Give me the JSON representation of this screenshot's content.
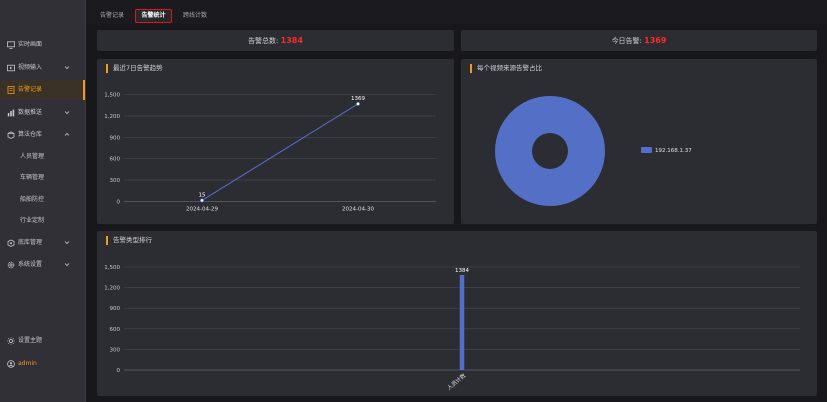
{
  "sidebar": {
    "items": [
      {
        "label": "实时画面",
        "icon": "monitor-icon"
      },
      {
        "label": "视频输入",
        "icon": "video-input-icon"
      },
      {
        "label": "告警记录",
        "icon": "alarm-record-icon"
      },
      {
        "label": "数据推送",
        "icon": "data-push-icon"
      },
      {
        "label": "算法仓库",
        "icon": "algorithm-icon"
      },
      {
        "label": "人员管理"
      },
      {
        "label": "车辆管理"
      },
      {
        "label": "船舶防控"
      },
      {
        "label": "行业定制"
      },
      {
        "label": "底库管理",
        "icon": "gallery-icon"
      },
      {
        "label": "系统设置",
        "icon": "settings-icon"
      }
    ],
    "theme_label": "设置主题",
    "user_label": "admin"
  },
  "tabs": [
    "告警记录",
    "告警统计",
    "跨线计数"
  ],
  "stats": {
    "total_label": "告警总数:",
    "total_value": "1384",
    "today_label": "今日告警:",
    "today_value": "1369"
  },
  "colors": {
    "accent": "#f39a1a",
    "alert": "#ff2a2a",
    "series": "#5470c6"
  },
  "charts": {
    "trend_title": "最近7日告警趋势",
    "source_title": "每个视频来源告警占比",
    "type_title": "告警类型排行"
  },
  "chart_data": [
    {
      "type": "line",
      "title": "最近7日告警趋势",
      "x": [
        "2024-04-29",
        "2024-04-30"
      ],
      "y_ticks": [
        "0",
        "300",
        "600",
        "900",
        "1,200",
        "1,500"
      ],
      "series": [
        {
          "values": [
            15,
            1369
          ],
          "labels": [
            "15",
            "1369"
          ]
        }
      ],
      "ylim": [
        0,
        1500
      ],
      "grid": true
    },
    {
      "type": "pie",
      "title": "每个视频来源告警占比",
      "donut": true,
      "legend_position": "right",
      "slices": [
        {
          "label": "192.168.1.37",
          "value": 1384
        }
      ]
    },
    {
      "type": "bar",
      "title": "告警类型排行",
      "categories": [
        "人员计数"
      ],
      "values": [
        1384
      ],
      "value_labels": [
        "1384"
      ],
      "y_ticks": [
        "0",
        "300",
        "600",
        "900",
        "1,200",
        "1,500"
      ],
      "ylim": [
        0,
        1500
      ],
      "grid": true
    }
  ]
}
